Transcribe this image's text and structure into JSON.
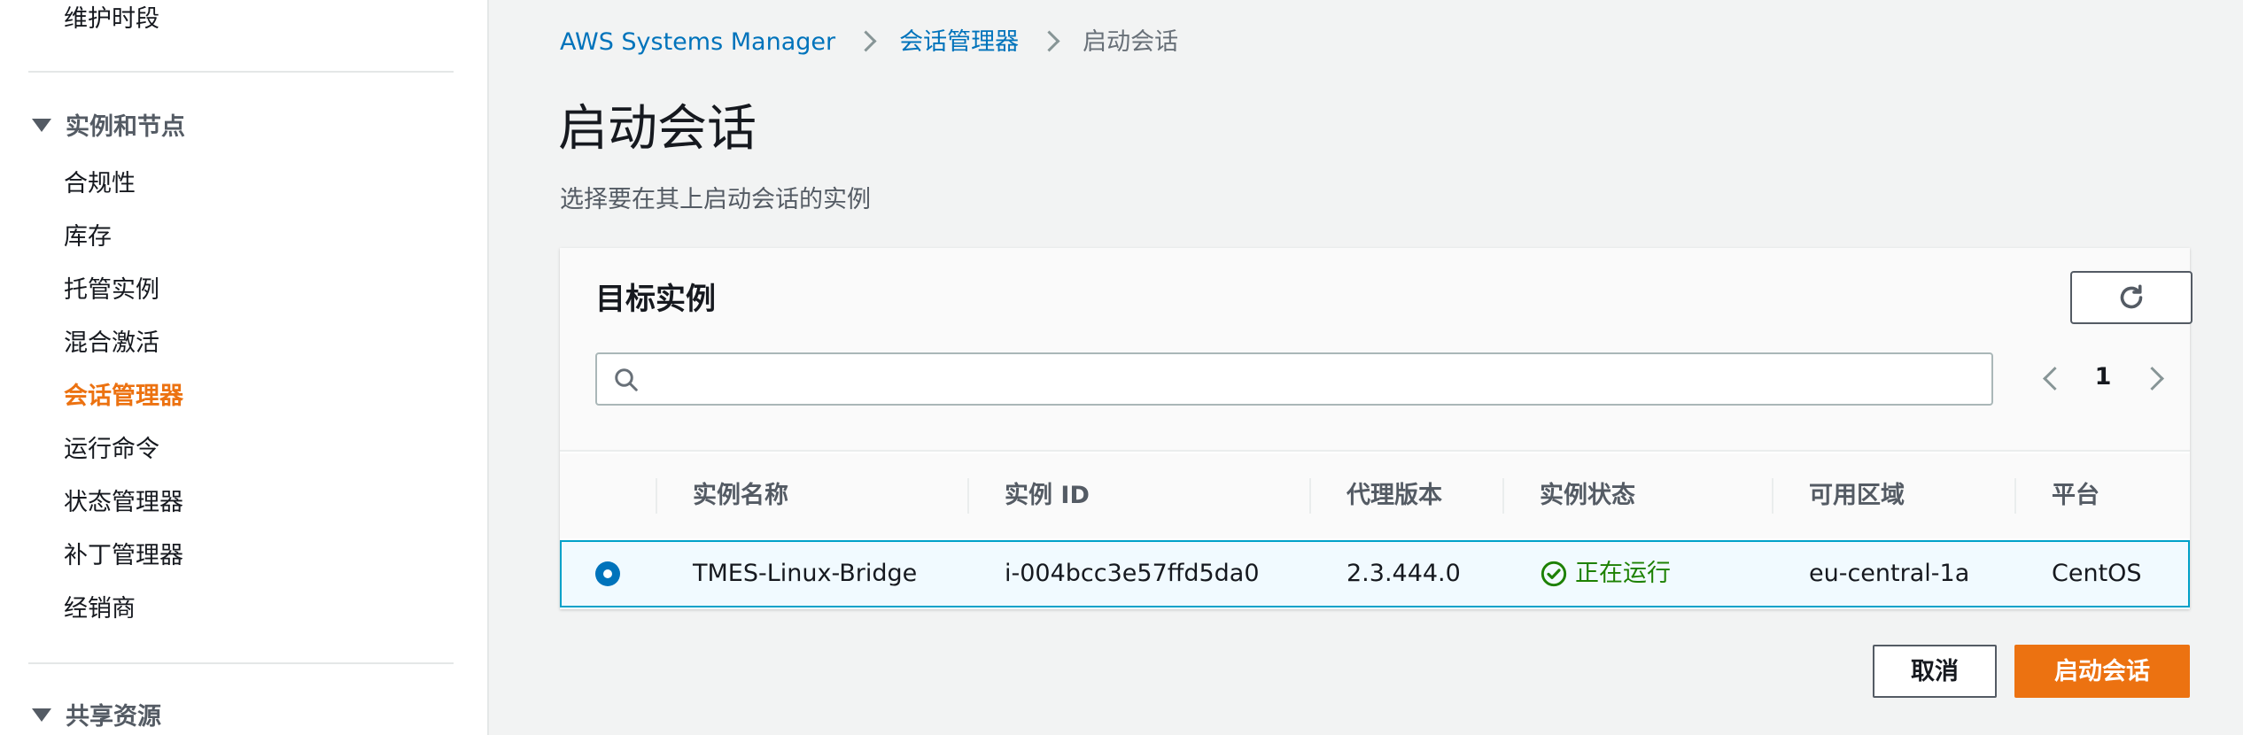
{
  "sidebar": {
    "top_item": "维护时段",
    "section_instances": "实例和节点",
    "items": [
      {
        "label": "合规性"
      },
      {
        "label": "库存"
      },
      {
        "label": "托管实例"
      },
      {
        "label": "混合激活"
      },
      {
        "label": "会话管理器",
        "active": true
      },
      {
        "label": "运行命令"
      },
      {
        "label": "状态管理器"
      },
      {
        "label": "补丁管理器"
      },
      {
        "label": "经销商"
      }
    ],
    "section_shared": "共享资源"
  },
  "breadcrumb": {
    "items": [
      "AWS Systems Manager",
      "会话管理器"
    ],
    "current": "启动会话"
  },
  "page": {
    "title": "启动会话",
    "description": "选择要在其上启动会话的实例"
  },
  "panel": {
    "title": "目标实例",
    "search": {
      "value": "",
      "placeholder": ""
    },
    "pagination": {
      "current_page": "1"
    },
    "columns": [
      "实例名称",
      "实例 ID",
      "代理版本",
      "实例状态",
      "可用区域",
      "平台"
    ],
    "rows": [
      {
        "selected": true,
        "name": "TMES-Linux-Bridge",
        "instance_id": "i-004bcc3e57ffd5da0",
        "agent_version": "2.3.444.0",
        "state": "正在运行",
        "availability_zone": "eu-central-1a",
        "platform": "CentOS"
      }
    ]
  },
  "actions": {
    "cancel": "取消",
    "start": "启动会话"
  },
  "colors": {
    "accent": "#ec7211",
    "link": "#0073bb",
    "running": "#1d8102",
    "selected_row_bg": "#f1faff",
    "selected_row_border": "#00a1c9"
  },
  "icons": [
    "search-icon",
    "refresh-icon",
    "chevron-left-icon",
    "chevron-right-icon",
    "check-circle-icon",
    "caret-down-icon",
    "breadcrumb-chevron-icon"
  ]
}
